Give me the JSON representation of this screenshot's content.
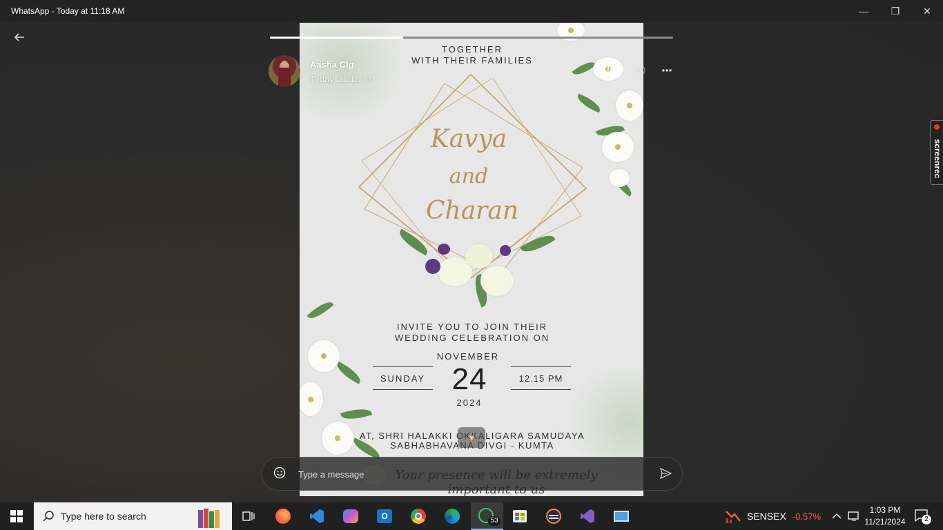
{
  "window": {
    "title": "WhatsApp - Today at 11:18 AM",
    "minimize": "—",
    "restore": "❐",
    "close": "✕"
  },
  "status": {
    "contact": "Aasha Clg",
    "time": "Today, 11:18 AM",
    "progress": 0.33
  },
  "card": {
    "together": "TOGETHER",
    "families": "WITH THEIR FAMILIES",
    "name1": "Kavya",
    "and": "and",
    "name2": "Charan",
    "invite1": "INVITE YOU TO JOIN THEIR",
    "invite2": "WEDDING CELEBRATION ON",
    "month": "NOVEMBER",
    "day_name": "SUNDAY",
    "day": "24",
    "clock": "12.15 PM",
    "year": "2024",
    "venue1": "AT, SHRI HALAKKI OKKALIGARA SAMUDAYA",
    "venue2": "SABHABHAVANA DIVGI - KUMTA",
    "closing": "Your presence will be extremely important to us"
  },
  "composer": {
    "placeholder": "Type a message"
  },
  "recorder": {
    "label": "screenrec"
  },
  "taskbar": {
    "search_placeholder": "Type here to search",
    "whatsapp_badge": "53",
    "stock_name": "SENSEX",
    "stock_change": "-0.57%",
    "clock_time": "1:03 PM",
    "clock_date": "11/21/2024",
    "notifications": "2"
  },
  "colors": {
    "accent_gold": "#b99459",
    "stock_negative": "#ff5a4e",
    "whatsapp_green": "#25d366"
  }
}
